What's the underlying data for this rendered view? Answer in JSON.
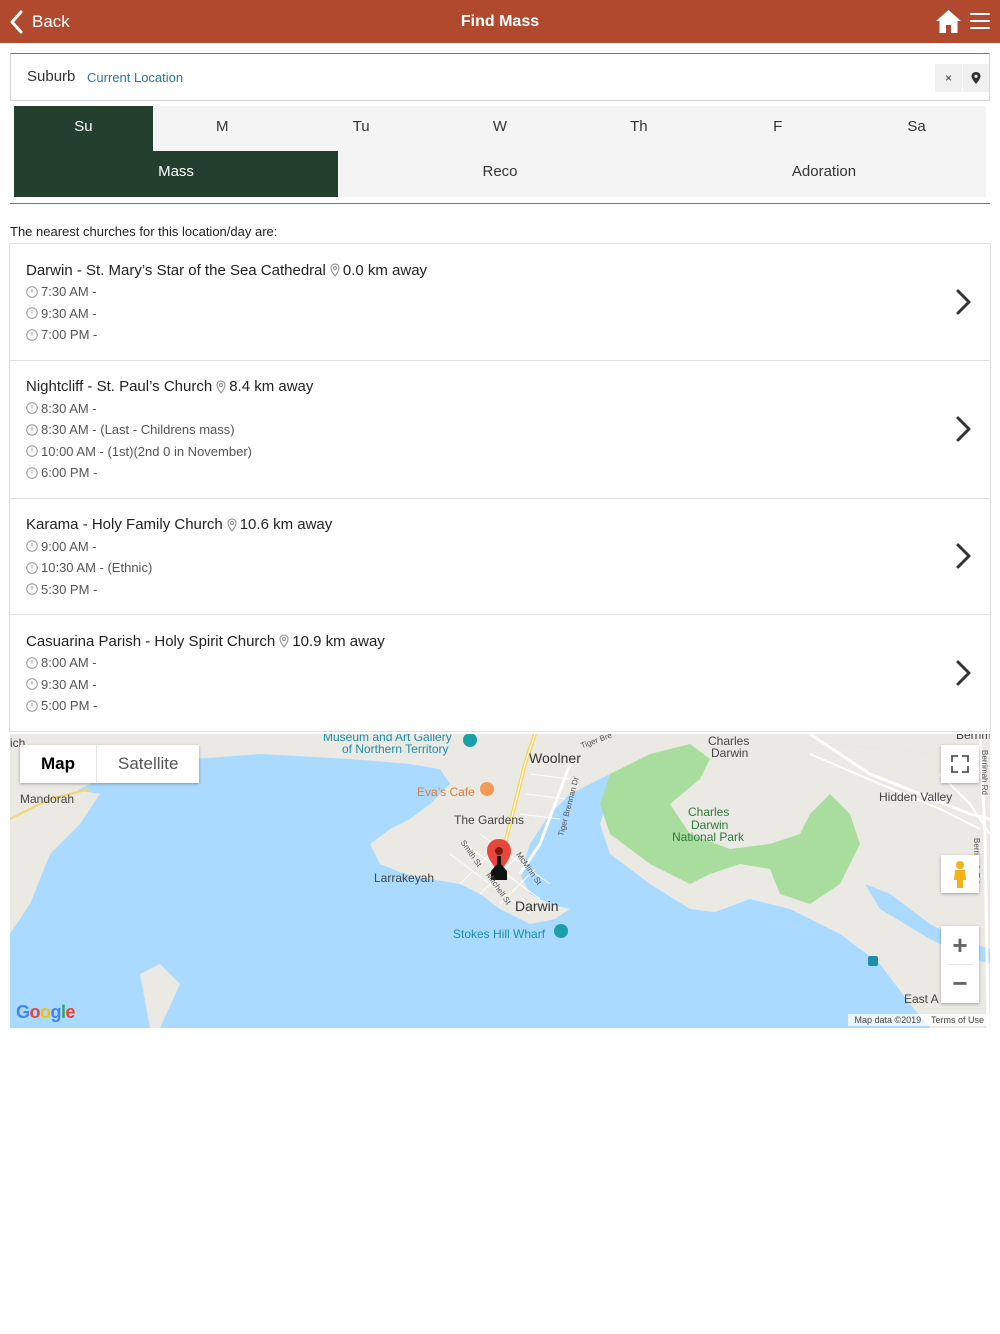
{
  "header": {
    "back_label": "Back",
    "title": "Find Mass",
    "icons": [
      "chevron-left-icon",
      "home-icon",
      "hamburger-menu-icon"
    ]
  },
  "search": {
    "label": "Suburb",
    "current_location": "Current Location",
    "clear": "×"
  },
  "days": [
    "Su",
    "M",
    "Tu",
    "W",
    "Th",
    "F",
    "Sa"
  ],
  "selected_day": "Su",
  "types": [
    "Mass",
    "Reco",
    "Adoration"
  ],
  "selected_type": "Mass",
  "intro": "The nearest churches for this location/day are:",
  "churches": [
    {
      "name": "Darwin - St. Mary’s Star of the Sea Cathedral",
      "distance": "0.0 km away",
      "times": [
        "7:30 AM -",
        "9:30 AM -",
        "7:00 PM -"
      ]
    },
    {
      "name": "Nightcliff - St. Paul’s Church",
      "distance": "8.4 km away",
      "times": [
        "8:30 AM -",
        "8:30 AM - (Last - Childrens mass)",
        "10:00 AM - (1st)(2nd 0 in November)",
        "6:00 PM -"
      ]
    },
    {
      "name": "Karama - Holy Family Church",
      "distance": "10.6 km away",
      "times": [
        "9:00 AM -",
        "10:30 AM - (Ethnic)",
        "5:30 PM -"
      ]
    },
    {
      "name": "Casuarina Parish - Holy Spirit Church",
      "distance": "10.9 km away",
      "times": [
        "8:00 AM -",
        "9:30 AM -",
        "5:00 PM -"
      ]
    }
  ],
  "map": {
    "type_map": "Map",
    "type_satellite": "Satellite",
    "labels": {
      "museum": "Museum and Art Gallery",
      "museum2": "of Northern Territory",
      "woolner": "Woolner",
      "charles_darwin": "Charles",
      "charles_darwin2": "Darwin",
      "mandorah": "Mandorah",
      "evas_cafe": "Eva’s Cafe",
      "the_gardens": "The Gardens",
      "park1": "Charles",
      "park2": "Darwin",
      "park3": "National Park",
      "hidden_valley": "Hidden Valley",
      "larrakeyah": "Larrakeyah",
      "darwin": "Darwin",
      "stokes": "Stokes Hill Wharf",
      "east": "East A",
      "smith": "Smith St",
      "mitchell": "Mitchell St",
      "mcminn": "McMinn St",
      "tiger_brennan": "Tiger Brennan Dr",
      "berrimah": "Berrimah Rd",
      "tiger_bre": "Tiger Bre",
      "ich": "ich",
      "berrim_top": "Berrim"
    },
    "attribution": "Map data ©2019",
    "terms": "Terms of Use",
    "google": "Google",
    "zoom_in": "+",
    "zoom_out": "−"
  },
  "colors": {
    "header": "#b0492d",
    "active_tab": "#23402e",
    "link": "#2a77a0",
    "water": "#aadaff",
    "park": "#a8dd9e"
  }
}
